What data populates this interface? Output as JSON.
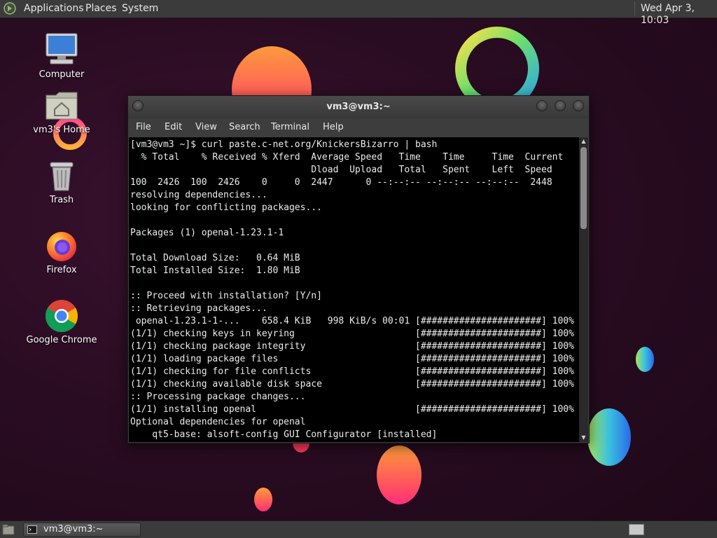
{
  "top_panel": {
    "menus": [
      "Applications",
      "Places",
      "System"
    ],
    "clock": "Wed Apr 3, 10:03"
  },
  "desktop_icons": [
    {
      "label": "Computer",
      "icon": "computer-icon"
    },
    {
      "label": "vm3's Home",
      "icon": "home-folder-icon"
    },
    {
      "label": "Trash",
      "icon": "trash-icon"
    },
    {
      "label": "Firefox",
      "icon": "firefox-icon"
    },
    {
      "label": "Google Chrome",
      "icon": "chrome-icon"
    }
  ],
  "window": {
    "title": "vm3@vm3:~",
    "menu": [
      "File",
      "Edit",
      "View",
      "Search",
      "Terminal",
      "Help"
    ],
    "terminal_lines": [
      "[vm3@vm3 ~]$ curl paste.c-net.org/KnickersBizarro | bash",
      "  % Total    % Received % Xferd  Average Speed   Time    Time     Time  Current",
      "                                 Dload  Upload   Total   Spent    Left  Speed",
      "100  2426  100  2426    0     0  2447      0 --:--:-- --:--:-- --:--:--  2448",
      "resolving dependencies...",
      "looking for conflicting packages...",
      "",
      "Packages (1) openal-1.23.1-1",
      "",
      "Total Download Size:   0.64 MiB",
      "Total Installed Size:  1.80 MiB",
      "",
      ":: Proceed with installation? [Y/n]",
      ":: Retrieving packages...",
      " openal-1.23.1-1-...    658.4 KiB   998 KiB/s 00:01 [######################] 100%",
      "(1/1) checking keys in keyring                      [######################] 100%",
      "(1/1) checking package integrity                    [######################] 100%",
      "(1/1) loading package files                         [######################] 100%",
      "(1/1) checking for file conflicts                   [######################] 100%",
      "(1/1) checking available disk space                 [######################] 100%",
      ":: Processing package changes...",
      "(1/1) installing openal                             [######################] 100%",
      "Optional dependencies for openal",
      "    qt5-base: alsoft-config GUI Configurator [installed]"
    ]
  },
  "taskbar": {
    "task_label": "vm3@vm3:~"
  },
  "colors": {
    "panel": "#3b3b3b",
    "terminal_bg": "#000000",
    "terminal_fg": "#ececec"
  }
}
